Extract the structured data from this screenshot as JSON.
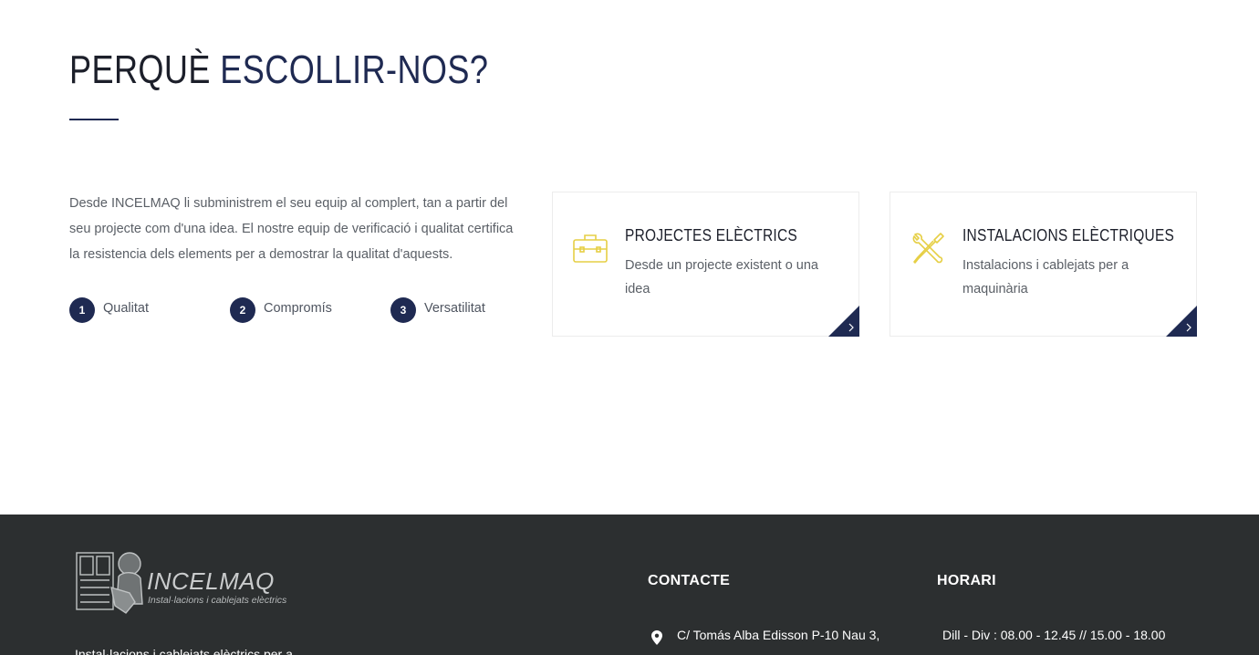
{
  "section": {
    "title_part1": "PERQUÈ",
    "title_part2": "ESCOLLIR-NOS?",
    "intro": "Desde INCELMAQ li subministrem el seu equip al complert, tan a partir del seu projecte com d'una idea. El nostre equip de verificació i qualitat certifica la resistencia dels elements per a demostrar la qualitat d'aquests.",
    "features": [
      {
        "num": "1",
        "label": "Qualitat"
      },
      {
        "num": "2",
        "label": "Compromís"
      },
      {
        "num": "3",
        "label": "Versatilitat"
      }
    ]
  },
  "cards": [
    {
      "icon": "toolbox-icon",
      "title": "PROJECTES ELÈCTRICS",
      "text": "Desde un projecte existent o una idea"
    },
    {
      "icon": "wrench-screwdriver-icon",
      "title": "INSTALACIONS ELÈCTRIQUES",
      "text": "Instalacions i cablejats per a maquinària"
    }
  ],
  "footer": {
    "logo_name": "INCELMAQ",
    "logo_tagline": "Instal·lacions i cablejats elèctrics",
    "description": "Instal·lacions i cablejats elèctrics per a",
    "contact_heading": "CONTACTE",
    "address": "C/ Tomás Alba Edisson P-10 Nau 3,",
    "hours_heading": "HORARI",
    "hours": "Dill - Div : 08.00 - 12.45 // 15.00 - 18.00"
  },
  "colors": {
    "navy": "#1f2a52",
    "accent_yellow": "#e6cf45",
    "footer_bg": "#2c2f30"
  }
}
